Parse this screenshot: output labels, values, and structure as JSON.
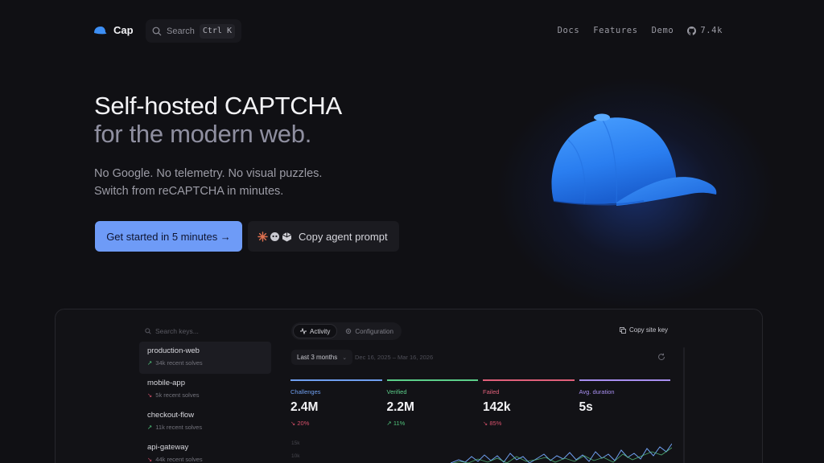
{
  "nav": {
    "brand": "Cap",
    "search_label": "Search",
    "search_shortcut": "Ctrl K",
    "links": [
      "Docs",
      "Features",
      "Demo"
    ],
    "github_stars": "7.4k"
  },
  "hero": {
    "title": "Self-hosted CAPTCHA",
    "subtitle": "for the modern web.",
    "desc_line1": "No Google. No telemetry. No visual puzzles.",
    "desc_line2": "Switch from reCAPTCHA in minutes.",
    "primary_cta": "Get started in 5 minutes →",
    "secondary_cta": "Copy agent prompt"
  },
  "dashboard": {
    "keys_search_placeholder": "Search keys...",
    "keys": [
      {
        "name": "production-web",
        "trend": "up",
        "solves": "34k recent solves"
      },
      {
        "name": "mobile-app",
        "trend": "down",
        "solves": "5k recent solves"
      },
      {
        "name": "checkout-flow",
        "trend": "up",
        "solves": "11k recent solves"
      },
      {
        "name": "api-gateway",
        "trend": "down",
        "solves": "44k recent solves"
      }
    ],
    "tabs": [
      "Activity",
      "Configuration"
    ],
    "copy_site_key": "Copy site key",
    "range_label": "Last 3 months",
    "range_dates": "Dec 16, 2025 – Mar 16, 2026",
    "stats": [
      {
        "label": "Challenges",
        "value": "2.4M",
        "delta": "20%",
        "trend": "down",
        "color": "#6f9ff0"
      },
      {
        "label": "Verified",
        "value": "2.2M",
        "delta": "11%",
        "trend": "up",
        "color": "#5ccf8a"
      },
      {
        "label": "Failed",
        "value": "142k",
        "delta": "85%",
        "trend": "down",
        "color": "#e0607a"
      },
      {
        "label": "Avg. duration",
        "value": "5s",
        "delta": "",
        "trend": "",
        "color": "#a88ff0"
      }
    ],
    "chart_axis": [
      "15k",
      "10k"
    ]
  },
  "colors": {
    "background": "#101014",
    "accent": "#6e9bf7",
    "hat": "#2f86f0"
  }
}
